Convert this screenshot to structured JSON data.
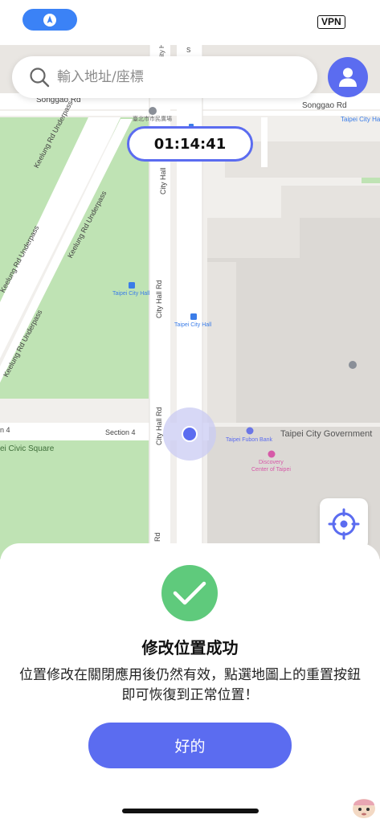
{
  "status_bar": {
    "nav_icon": "location-arrow-icon",
    "vpn_label": "VPN"
  },
  "search": {
    "placeholder": "輸入地址/座標",
    "icon": "search-icon"
  },
  "profile": {
    "icon": "user-icon"
  },
  "timer": {
    "value": "01:14:41"
  },
  "map": {
    "labels": {
      "songgao_left": "Songgao Rd",
      "songgao_right": "Songgao Rd",
      "taipei_city_hall_plaza": "臺北市市民廣場",
      "taipei_city_hall_top_right": "Taipei City Hall",
      "keelung_underpass_1": "Keelung Rd Underpass",
      "keelung_underpass_2": "Keelung Rd Underpass",
      "keelung_underpass_3": "Keelung Rd Underpass",
      "keelung_underpass_4": "Keelung Rd Underpass",
      "city_hall_rd_1": "City Hall",
      "city_hall_rd_2": "City Hall Rd",
      "city_hall_rd_3": "City Hall Rd",
      "city_hall_rd_4": "Rd",
      "city_hall_top": "City Hall",
      "taipei_city_hall_station_1": "Taipei City Hall",
      "taipei_city_hall_station_2": "Taipei City Hall",
      "section4_left": "n 4",
      "section4_mid": "Section 4",
      "civic_square": "ei Civic Square",
      "taipei_city_government": "Taipei City Government",
      "taipei_fubon_bank": "Taipei Fubon Bank",
      "discovery_center_line1": "Discovery",
      "discovery_center_line2": "Center of Taipei",
      "top_s": "S"
    }
  },
  "locate_button": {
    "icon": "crosshair-icon"
  },
  "dialog": {
    "icon": "checkmark-icon",
    "title": "修改位置成功",
    "message": "位置修改在關閉應用後仍然有效，點選地圖上的重置按鈕即可恢復到正常位置！",
    "ok_label": "好的"
  },
  "colors": {
    "accent": "#5b6cf0",
    "success": "#5fca7c",
    "park": "#bfe3b4",
    "map_bg": "#f1efec",
    "building": "#dcd9d5"
  }
}
